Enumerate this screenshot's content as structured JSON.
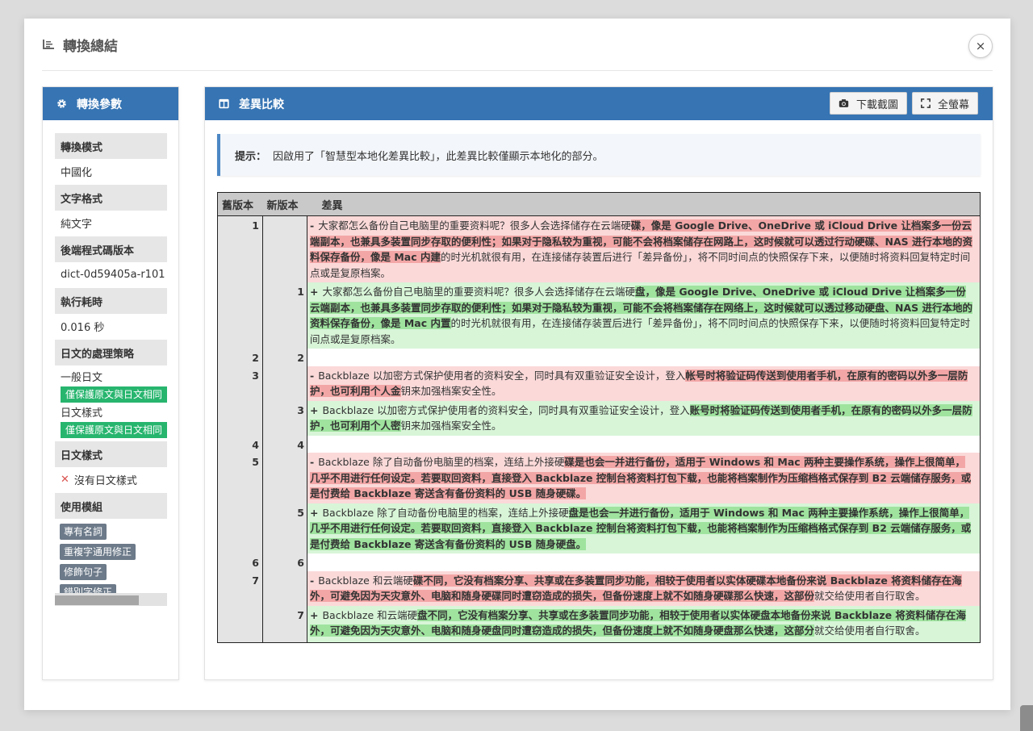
{
  "modal": {
    "title": "轉換總結",
    "close_label": "×"
  },
  "params": {
    "header": "轉換參數",
    "conversion_mode_label": "轉換模式",
    "conversion_mode": "中國化",
    "text_format_label": "文字格式",
    "text_format": "純文字",
    "backend_version_label": "後端程式碼版本",
    "backend_version": "dict-0d59405a-r101",
    "elapsed_label": "執行耗時",
    "elapsed": "0.016 秒",
    "jp_strategy_label": "日文的處理策略",
    "jp_general": "一般日文",
    "jp_general_tag": "僅保護原文與日文相同",
    "jp_style": "日文樣式",
    "jp_style_tag": "僅保護原文與日文相同",
    "jp_style_section_label": "日文樣式",
    "jp_style_none": "沒有日文樣式",
    "modules_label": "使用模組",
    "modules": [
      "專有名詞",
      "重複字通用修正",
      "修飾句子",
      "錯別字修正"
    ]
  },
  "diff": {
    "header": "差異比較",
    "download_label": "下載截圖",
    "fullscreen_label": "全螢幕",
    "hint_label": "提示：",
    "hint_text": "因啟用了「智慧型本地化差異比較」，此差異比較僅顯示本地化的部分。",
    "col_old": "舊版本",
    "col_new": "新版本",
    "col_diff": "差異",
    "rows": [
      {
        "type": "del",
        "old": "1",
        "new": "",
        "sign": "-",
        "parts": [
          [
            "n",
            "大家都怎么备份自己电脑里的重要资料呢？很多人会选择储存在云端硬"
          ],
          [
            "h",
            "碟，像是 Google Drive、OneDrive 或 iCloud Drive 让档案多一份云端副本，也兼具多装置同步存取的便利性；如果对于隐私较为重视，可能不会将档案储存在网路上，这时候就可以透过行动硬碟、NAS 进行本地的资料保存备份，像是 Mac 内建"
          ],
          [
            "n",
            "的时光机就很有用，在连接储存装置后进行「差异备份」，将不同时间点的快照保存下来，以便随时将资料回复特定时间点或是复原档案。"
          ]
        ]
      },
      {
        "type": "ins",
        "old": "",
        "new": "1",
        "sign": "+",
        "parts": [
          [
            "n",
            "大家都怎么备份自己电脑里的重要资料呢？很多人会选择储存在云端硬"
          ],
          [
            "h",
            "盘，像是 Google Drive、OneDrive 或 iCloud Drive 让档案多一份云端副本，也兼具多装置同步存取的便利性；如果对于隐私较为重视，可能不会将档案储存在网络上，这时候就可以透过移动硬盘、NAS 进行本地的资料保存备份，像是 Mac 内置"
          ],
          [
            "n",
            "的时光机就很有用，在连接储存装置后进行「差异备份」，将不同时间点的快照保存下来，以便随时将资料回复特定时间点或是复原档案。"
          ]
        ]
      },
      {
        "type": "same",
        "old": "2",
        "new": "2"
      },
      {
        "type": "del",
        "old": "3",
        "new": "",
        "sign": "-",
        "parts": [
          [
            "n",
            "Backblaze 以加密方式保护使用者的资料安全，同时具有双重验证安全设计，登入"
          ],
          [
            "h",
            "帐号时将验证码传送到使用者手机，在原有的密码以外多一层防护，也可利用个人金"
          ],
          [
            "n",
            "钥来加强档案安全性。"
          ]
        ]
      },
      {
        "type": "ins",
        "old": "",
        "new": "3",
        "sign": "+",
        "parts": [
          [
            "n",
            "Backblaze 以加密方式保护使用者的资料安全，同时具有双重验证安全设计，登入"
          ],
          [
            "h",
            "账号时将验证码传送到使用者手机，在原有的密码以外多一层防护，也可利用个人密"
          ],
          [
            "n",
            "钥来加强档案安全性。"
          ]
        ]
      },
      {
        "type": "same",
        "old": "4",
        "new": "4"
      },
      {
        "type": "del",
        "old": "5",
        "new": "",
        "sign": "-",
        "parts": [
          [
            "n",
            "Backblaze 除了自动备份电脑里的档案，连结上外接硬"
          ],
          [
            "h",
            "碟是也会一并进行备份，适用于 Windows 和 Mac 两种主要操作系统，操作上很简单，几乎不用进行任何设定。若要取回资料，直接登入 Backblaze 控制台将资料打包下载，也能将档案制作为压缩档格式保存到 B2 云端储存服务，或是付费给 Backblaze 寄送含有备份资料的 USB 随身硬碟。"
          ]
        ]
      },
      {
        "type": "ins",
        "old": "",
        "new": "5",
        "sign": "+",
        "parts": [
          [
            "n",
            "Backblaze 除了自动备份电脑里的档案，连结上外接硬"
          ],
          [
            "h",
            "盘是也会一并进行备份，适用于 Windows 和 Mac 两种主要操作系统，操作上很简单，几乎不用进行任何设定。若要取回资料，直接登入 Backblaze 控制台将资料打包下载，也能将档案制作为压缩档格式保存到 B2 云端储存服务，或是付费给 Backblaze 寄送含有备份资料的 USB 随身硬盘。"
          ]
        ]
      },
      {
        "type": "same",
        "old": "6",
        "new": "6"
      },
      {
        "type": "del",
        "old": "7",
        "new": "",
        "sign": "-",
        "parts": [
          [
            "n",
            "Backblaze 和云端硬"
          ],
          [
            "h",
            "碟不同，它没有档案分享、共享或在多装置同步功能，相较于使用者以实体硬碟本地备份来说 Backblaze 将资料储存在海外，可避免因为天灾意外、电脑和随身硬碟同时遭窃造成的损失，但备份速度上就不如随身硬碟那么快速，这部份"
          ],
          [
            "n",
            "就交给使用者自行取舍。"
          ]
        ]
      },
      {
        "type": "ins",
        "old": "",
        "new": "7",
        "sign": "+",
        "parts": [
          [
            "n",
            "Backblaze 和云端硬"
          ],
          [
            "h",
            "盘不同，它没有档案分享、共享或在多装置同步功能，相较于使用者以实体硬盘本地备份来说 Backblaze 将资料储存在海外，可避免因为天灾意外、电脑和随身硬盘同时遭窃造成的损失，但备份速度上就不如随身硬盘那么快速，这部分"
          ],
          [
            "n",
            "就交给使用者自行取舍。"
          ]
        ]
      }
    ]
  },
  "colors": {
    "header_blue": "#3674b3",
    "del_bg": "#fbd9d9",
    "del_hl": "#f3a6a6",
    "ins_bg": "#d8f5d8",
    "ins_hl": "#9fe39f",
    "tag_green": "#27b56e"
  }
}
